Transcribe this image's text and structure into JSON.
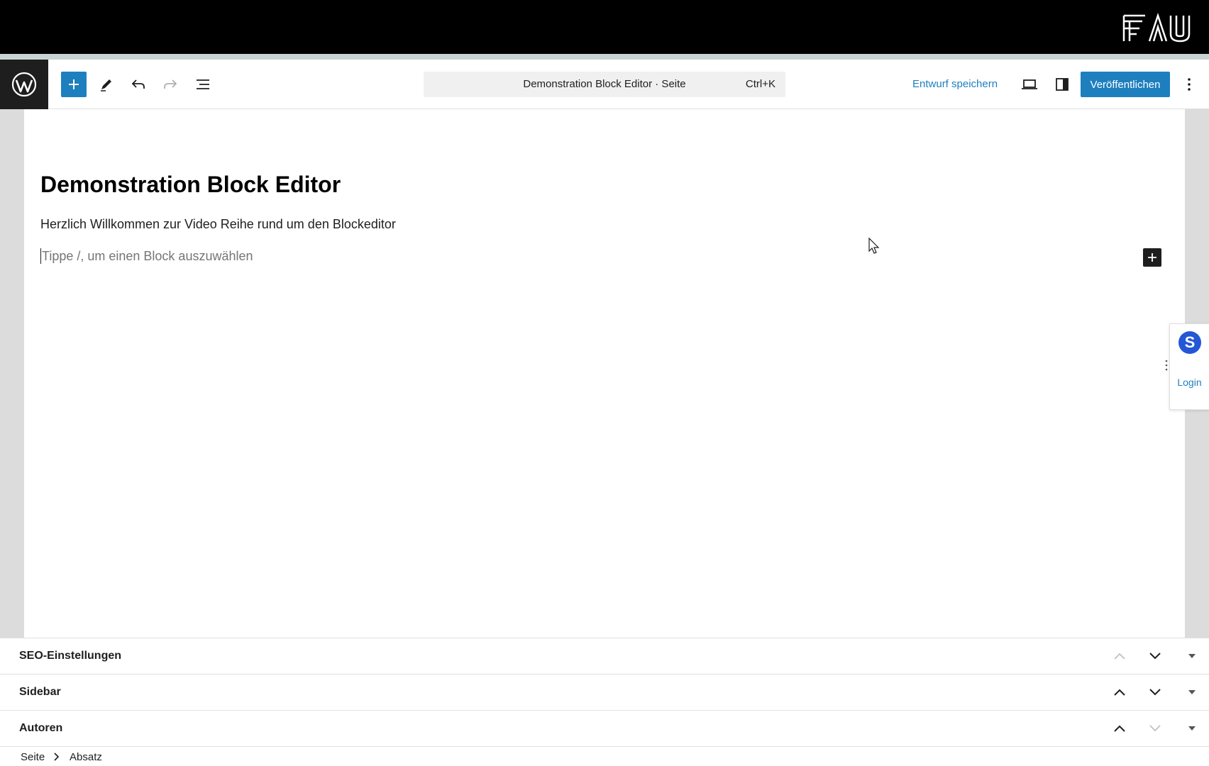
{
  "brand": {
    "logo_text": "FAU"
  },
  "toolbar": {
    "command_title": "Demonstration Block Editor · Seite",
    "command_shortcut": "Ctrl+K",
    "save_draft_label": "Entwurf speichern",
    "publish_label": "Veröffentlichen"
  },
  "editor": {
    "title": "Demonstration Block Editor",
    "paragraph": "Herzlich Willkommen zur Video Reihe rund um den Blockeditor",
    "placeholder": "Tippe /, um einen Block auszuwählen"
  },
  "side_widget": {
    "logo_letter": "S",
    "login_label": "Login"
  },
  "metaboxes": [
    {
      "label": "SEO-Einstellungen"
    },
    {
      "label": "Sidebar"
    },
    {
      "label": "Autoren"
    }
  ],
  "breadcrumb": [
    "Seite",
    "Absatz"
  ],
  "colors": {
    "accent": "#1e7fbf",
    "dark": "#1e1e1e",
    "canvas_bg": "#dcdcdc",
    "side_logo": "#2457d6"
  }
}
